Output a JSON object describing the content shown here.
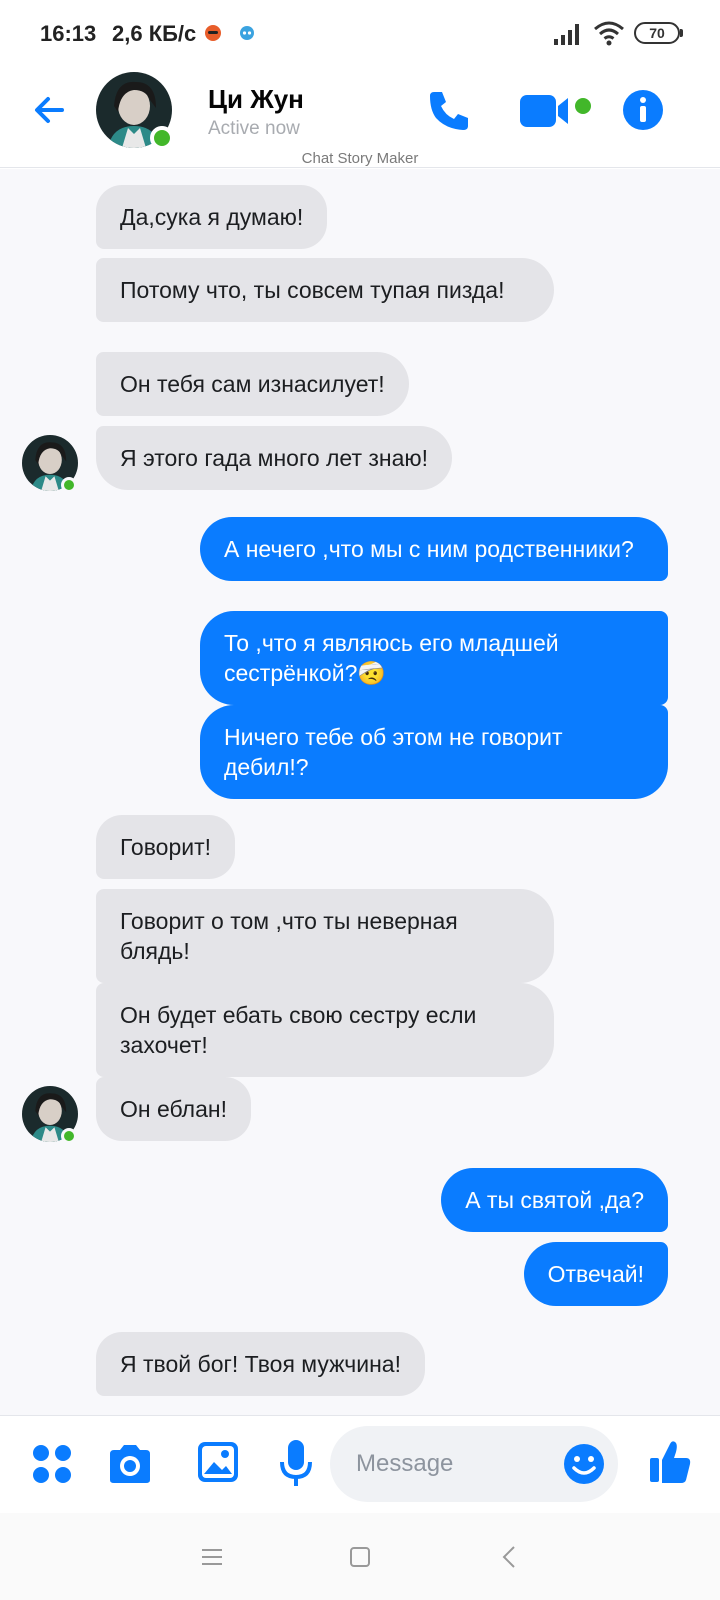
{
  "status_bar": {
    "time": "16:13",
    "speed": "2,6 КБ/с",
    "battery": "70"
  },
  "header": {
    "contact_name": "Ци Жун",
    "status": "Active now",
    "watermark": "Chat Story Maker",
    "accent_color": "#0a7cff",
    "online_color": "#42b72a"
  },
  "messages": [
    {
      "side": "in",
      "text": "Да,сука я думаю!"
    },
    {
      "side": "in",
      "text": "Потому что, ты совсем тупая пизда!"
    },
    {
      "side": "in",
      "text": "Он тебя сам изнасилует!"
    },
    {
      "side": "in",
      "text": "Я этого гада много лет знаю!"
    },
    {
      "side": "out",
      "text": "А нечего ,что мы с ним родственники?"
    },
    {
      "side": "out",
      "text": "То ,что я являюсь его младшей сестрёнкой?🤕"
    },
    {
      "side": "out",
      "text": "Ничего тебе об этом не говорит дебил!?"
    },
    {
      "side": "in",
      "text": "Говорит!"
    },
    {
      "side": "in",
      "text": "Говорит о том ,что ты неверная блядь!"
    },
    {
      "side": "in",
      "text": "Он будет ебать свою сестру если захочет!"
    },
    {
      "side": "in",
      "text": "Он еблан!"
    },
    {
      "side": "out",
      "text": "А ты святой ,да?"
    },
    {
      "side": "out",
      "text": "Отвечай!"
    },
    {
      "side": "in",
      "text": "Я твой бог! Твоя мужчина!"
    }
  ],
  "composer": {
    "placeholder": "Message"
  },
  "icons": [
    "back-arrow-icon",
    "phone-icon",
    "video-camera-icon",
    "info-icon",
    "apps-grid-icon",
    "camera-icon",
    "gallery-icon",
    "microphone-icon",
    "emoji-icon",
    "thumbs-up-icon"
  ]
}
